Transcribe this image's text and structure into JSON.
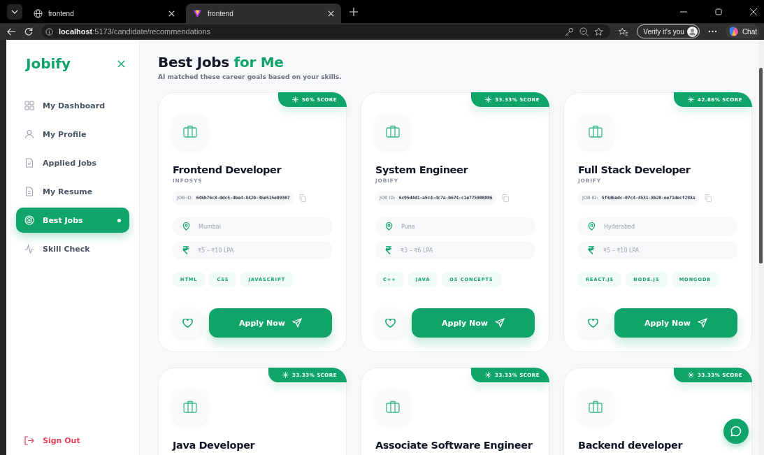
{
  "browser": {
    "tabs": [
      {
        "title": "frontend",
        "selected": false
      },
      {
        "title": "frontend",
        "selected": true
      }
    ],
    "url": "**localhost**:5173/candidate/recommendations",
    "verify_label": "Verify it's you",
    "chat_label": "Chat"
  },
  "sidebar": {
    "logo": "Jobify",
    "items": [
      {
        "label": "My Dashboard",
        "selected": false
      },
      {
        "label": "My Profile",
        "selected": false
      },
      {
        "label": "Applied Jobs",
        "selected": false
      },
      {
        "label": "My Resume",
        "selected": false
      },
      {
        "label": "Best Jobs",
        "selected": true
      },
      {
        "label": "Skill Check",
        "selected": false
      }
    ],
    "sign_out": "Sign Out"
  },
  "header": {
    "title": "Best Jobs",
    "title_highlight": "for Me",
    "subtitle": "AI matched these career goals based on your skills."
  },
  "jobs": [
    {
      "score": "50% SCORE",
      "title": "Frontend Developer",
      "company": "INFOSYS",
      "job_id_label": "JOB ID:",
      "job_id": "646b76c8-ddc5-4ba4-8420-36e515e09307",
      "location": "Mumbai",
      "salary": "₹5 – ₹10 LPA",
      "skills": [
        "HTML",
        "CSS",
        "JAVASCRIPT"
      ],
      "apply_label": "Apply Now"
    },
    {
      "score": "33.33% SCORE",
      "title": "System Engineer",
      "company": "JOBIFY",
      "job_id_label": "JOB ID:",
      "job_id": "6c95d4d1-a5c4-4c7a-b674-c1e775900006",
      "location": "Pune",
      "salary": "₹3 – ₹6 LPA",
      "skills": [
        "C++",
        "JAVA",
        "OS CONCEPTS"
      ],
      "apply_label": "Apply Now"
    },
    {
      "score": "42.86% SCORE",
      "title": "Full Stack Developer",
      "company": "JOBIFY",
      "job_id_label": "JOB ID:",
      "job_id": "5f3d6adc-07c4-4531-8b28-ee71decf298a",
      "location": "Hyderabad",
      "salary": "₹5 – ₹10 LPA",
      "skills": [
        "REACT.JS",
        "NODE.JS",
        "MONGODB"
      ],
      "apply_label": "Apply Now"
    },
    {
      "score": "33.33% SCORE",
      "title": "Java Developer"
    },
    {
      "score": "33.33% SCORE",
      "title": "Associate Software Engineer"
    },
    {
      "score": "33.33% SCORE",
      "title": "Backend developer"
    }
  ]
}
